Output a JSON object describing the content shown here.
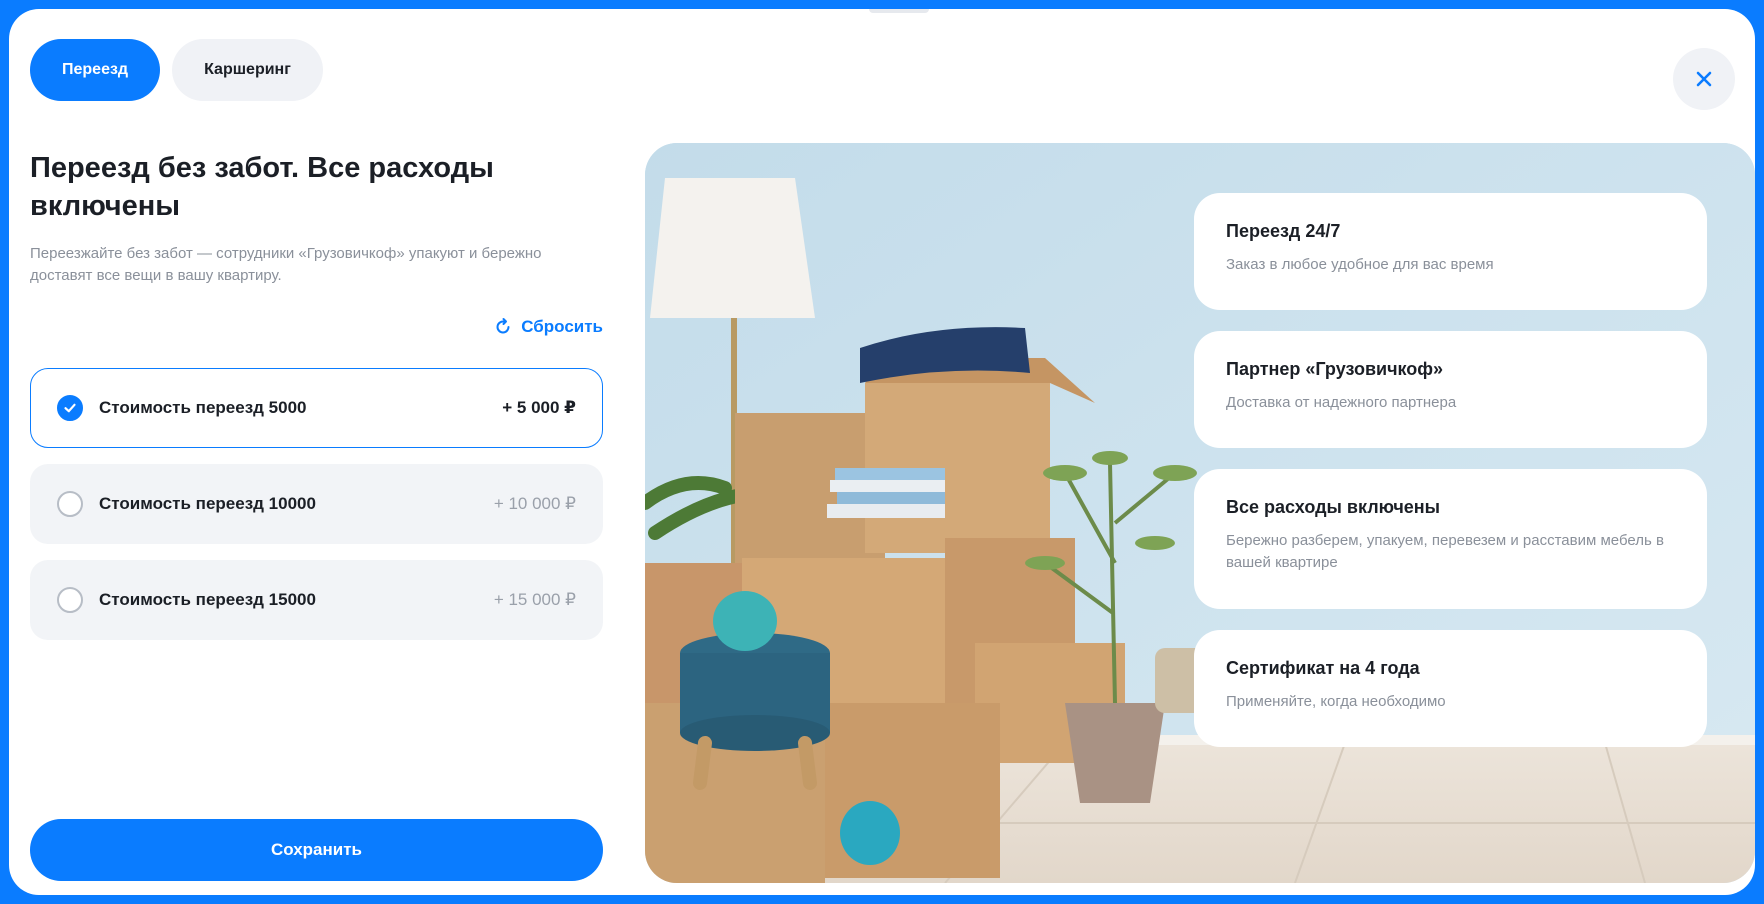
{
  "tabs": [
    {
      "label": "Переезд",
      "active": true
    },
    {
      "label": "Каршеринг",
      "active": false
    }
  ],
  "left": {
    "title": "Переезд без забот. Все расходы включены",
    "description": "Переезжайте без забот — сотрудники «Грузовичкоф» упакуют и бережно доставят все вещи в вашу квартиру.",
    "reset_label": "Сбросить"
  },
  "options": [
    {
      "label": "Стоимость переезд 5000",
      "price": "+ 5 000 ₽",
      "selected": true
    },
    {
      "label": "Стоимость переезд 10000",
      "price": "+ 10 000 ₽",
      "selected": false
    },
    {
      "label": "Стоимость переезд 15000",
      "price": "+ 15 000 ₽",
      "selected": false
    }
  ],
  "save_label": "Сохранить",
  "cards": [
    {
      "title": "Переезд 24/7",
      "text": "Заказ в любое удобное для вас время"
    },
    {
      "title": "Партнер «Грузовичкоф»",
      "text": "Доставка от надежного партнера"
    },
    {
      "title": "Все расходы включены",
      "text": "Бережно разберем, упакуем, перевезем и расставим мебель в вашей квартире"
    },
    {
      "title": "Сертификат на 4 года",
      "text": "Применяйте, когда необходимо"
    }
  ],
  "colors": {
    "accent": "#0a7cff",
    "background": "#ffffff",
    "muted": "#8a909a"
  },
  "icons": {
    "close": "close-icon",
    "reset": "refresh-icon",
    "check": "checkmark-icon"
  }
}
